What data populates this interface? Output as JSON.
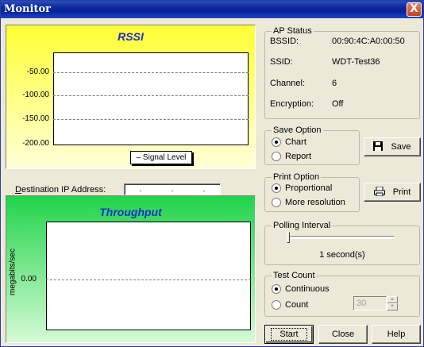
{
  "window": {
    "title": "Monitor",
    "close_glyph": "X"
  },
  "rssi_chart": {
    "title": "RSSI",
    "ticks": [
      "-50.00",
      "-100.00",
      "-150.00",
      "-200.00"
    ],
    "legend": "Signal Level"
  },
  "destination": {
    "label": "Destination IP Address:",
    "octets": [
      ".",
      ".",
      "."
    ]
  },
  "throughput_chart": {
    "title": "Throughput",
    "ylabel": "megabits/sec",
    "tick": "0.00"
  },
  "ap_status": {
    "title": "AP Status",
    "rows": [
      {
        "label": "BSSID:",
        "value": "00:90:4C:A0:00:50"
      },
      {
        "label": "SSID:",
        "value": "WDT-Test36"
      },
      {
        "label": "Channel:",
        "value": "6"
      },
      {
        "label": "Encryption:",
        "value": "Off"
      }
    ]
  },
  "save_option": {
    "title": "Save Option",
    "options": [
      "Chart",
      "Report"
    ],
    "selected": "Chart",
    "button": "Save"
  },
  "print_option": {
    "title": "Print Option",
    "options": [
      "Proportional",
      "More resolution"
    ],
    "selected": "Proportional",
    "button": "Print"
  },
  "polling": {
    "title": "Polling Interval",
    "value_text": "1 second(s)",
    "slider_level": 0
  },
  "test_count": {
    "title": "Test Count",
    "options": [
      "Continuous",
      "Count"
    ],
    "selected": "Continuous",
    "count_value": "30"
  },
  "buttons": {
    "start": "Start",
    "close": "Close",
    "help": "Help"
  },
  "icons": {
    "save": "floppy-disk-icon",
    "print": "printer-icon"
  },
  "colors": {
    "rssi_bg": "#ffff33",
    "throughput_bg": "#21d44a",
    "chart_title": "#1a2fd0"
  },
  "chart_data": [
    {
      "type": "line",
      "title": "RSSI",
      "yticks": [
        -50,
        -100,
        -150,
        -200
      ],
      "ylim": [
        -200,
        -25
      ],
      "series": [
        {
          "name": "Signal Level",
          "values": []
        }
      ],
      "grid": true
    },
    {
      "type": "line",
      "title": "Throughput",
      "ylabel": "megabits/sec",
      "yticks": [
        0
      ],
      "series": [],
      "grid": true
    }
  ]
}
